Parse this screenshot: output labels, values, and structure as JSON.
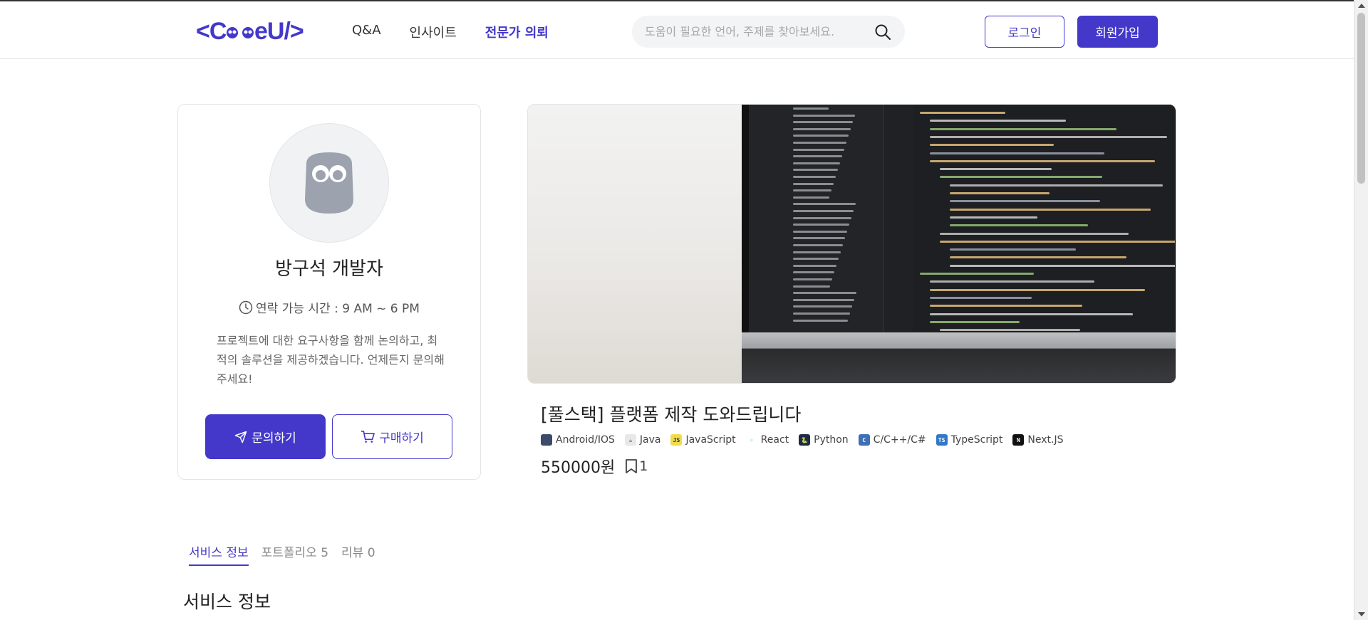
{
  "header": {
    "logo": "<CodeU/>",
    "nav": [
      {
        "label": "Q&A",
        "active": false
      },
      {
        "label": "인사이트",
        "active": false
      },
      {
        "label": "전문가 의뢰",
        "active": true
      }
    ],
    "search_placeholder": "도움이 필요한 언어, 주제를 찾아보세요.",
    "login_label": "로그인",
    "signup_label": "회원가입"
  },
  "profile": {
    "name": "방구석 개발자",
    "contact_time": "연락 가능 시간 : 9 AM ~ 6 PM",
    "description": "프로젝트에 대한 요구사항을 함께 논의하고, 최적의 솔루션을 제공하겠습니다. 언제든지 문의해 주세요!",
    "inquiry_label": "문의하기",
    "buy_label": "구매하기"
  },
  "service": {
    "title": "[풀스택] 플랫폼 제작 도와드립니다",
    "tags": [
      {
        "label": "Android/IOS",
        "icon": "android-ios-icon",
        "color": "#3c4a6b",
        "glyph": ""
      },
      {
        "label": "Java",
        "icon": "java-icon",
        "color": "#e8e8e8",
        "glyph": "☕"
      },
      {
        "label": "JavaScript",
        "icon": "javascript-icon",
        "color": "#f0db4f",
        "glyph": "JS"
      },
      {
        "label": "React",
        "icon": "react-icon",
        "color": "#ffffff",
        "glyph": "⚛"
      },
      {
        "label": "Python",
        "icon": "python-icon",
        "color": "#1f2a44",
        "glyph": "🐍"
      },
      {
        "label": "C/C++/C#",
        "icon": "cpp-icon",
        "color": "#3f6fb5",
        "glyph": "C"
      },
      {
        "label": "TypeScript",
        "icon": "typescript-icon",
        "color": "#3178c6",
        "glyph": "TS"
      },
      {
        "label": "Next.JS",
        "icon": "nextjs-icon",
        "color": "#111111",
        "glyph": "N"
      }
    ],
    "price": "550000원",
    "bookmark_count": "1"
  },
  "tabs": [
    {
      "label": "서비스 정보",
      "active": true
    },
    {
      "label": "포트폴리오 5",
      "active": false
    },
    {
      "label": "리뷰 0",
      "active": false
    }
  ],
  "section_title": "서비스 정보",
  "colors": {
    "accent": "#4338ca"
  }
}
